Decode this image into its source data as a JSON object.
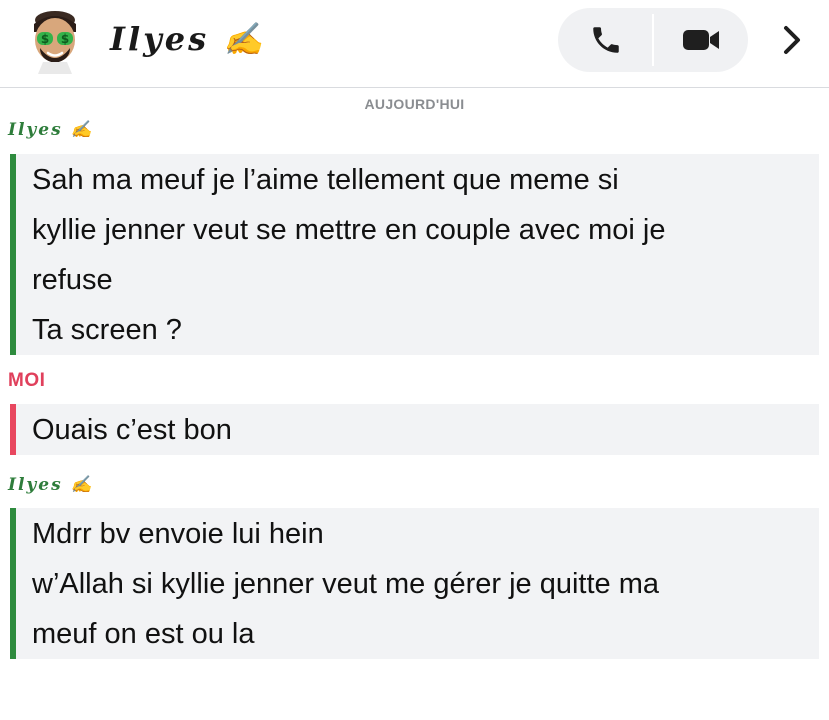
{
  "header": {
    "contact_name": "Ilyes ✍️",
    "avatar_icon": "money-eyes-emoji-avatar-icon",
    "voice_call_icon": "phone-icon",
    "video_call_icon": "video-camera-icon",
    "more_icon": "chevron-right-icon"
  },
  "chat": {
    "date_separator": "AUJOURD'HUI",
    "groups": [
      {
        "sender": "Ilyes ✍️",
        "lines": [
          "Sah ma meuf je l’aime tellement que meme si",
          "kyllie jenner veut se mettre en couple avec moi je",
          "refuse",
          "Ta screen ?"
        ]
      },
      {
        "sender": "MOI",
        "lines": [
          "Ouais c’est bon"
        ]
      },
      {
        "sender": "Ilyes ✍️",
        "lines": [
          "Mdrr bv envoie lui hein",
          "w’Allah si kyllie jenner veut me gérer je quitte ma",
          "meuf on est ou la"
        ]
      }
    ]
  },
  "colors": {
    "friend_accent": "#2e8b3e",
    "me_accent": "#e8475f",
    "bubble_bg": "#f2f3f5",
    "separator_text": "#8a8d91"
  }
}
